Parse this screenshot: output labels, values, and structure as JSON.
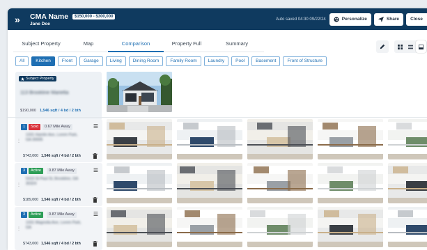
{
  "header": {
    "title": "CMA Name",
    "price_range": "$150,000 - $300,000",
    "owner": "Jane Doe",
    "autosave": "Auto saved 04:30 09/22/24",
    "personalize_label": "Personalize",
    "share_label": "Share",
    "close_label": "Close"
  },
  "tabs": [
    {
      "label": "Subject Property",
      "active": false
    },
    {
      "label": "Map",
      "active": false
    },
    {
      "label": "Comparison",
      "active": true
    },
    {
      "label": "Property Full",
      "active": false
    },
    {
      "label": "Summary",
      "active": false
    }
  ],
  "filters": [
    "All",
    "Kitchen",
    "Front",
    "Garage",
    "Living",
    "Dining Room",
    "Family Room",
    "Laundry",
    "Pool",
    "Basement",
    "Front of Structure"
  ],
  "active_filter": "Kitchen",
  "subject": {
    "badge": "Subject Property",
    "address": "113 Brookline Marietta",
    "price": "$190,000",
    "spec": "1,546 sqft / 4 bd / 2 bth"
  },
  "comps": [
    {
      "num": "1",
      "status": "Sold",
      "distance": "0.67 Mile Away",
      "address": "1331 Hamlin Ave, Lorem Park, GA 30005",
      "price": "$743,000",
      "spec": "1,546 sqft / 4 bd / 2 bth"
    },
    {
      "num": "3",
      "status": "Active",
      "distance": "0.87 Mile Away",
      "address": "5419 St Paul St, Brookline, GA 30324",
      "price": "$189,000",
      "spec": "1,546 sqft / 4 bd / 2 bth"
    },
    {
      "num": "3",
      "status": "Active",
      "distance": "0.87 Mile Away",
      "address": "1331 Magnolia Ave, Lorem Park, GA",
      "price": "$743,000",
      "spec": "1,546 sqft / 4 bd / 2 bth"
    }
  ],
  "icons": {
    "collapse": "double-chevron-right-icon",
    "personalize": "palette-icon",
    "share": "send-icon",
    "edit": "pencil-icon",
    "view_grid": "grid-icon",
    "view_list": "list-icon",
    "view_single": "single-view-icon",
    "card_menu": "hamburger-menu-icon",
    "delete": "trash-icon",
    "subject_badge": "star-icon"
  },
  "colors": {
    "header": "#0f3a5f",
    "accent": "#1f6fb3",
    "sold": "#d9313a",
    "active": "#2e9e57"
  }
}
